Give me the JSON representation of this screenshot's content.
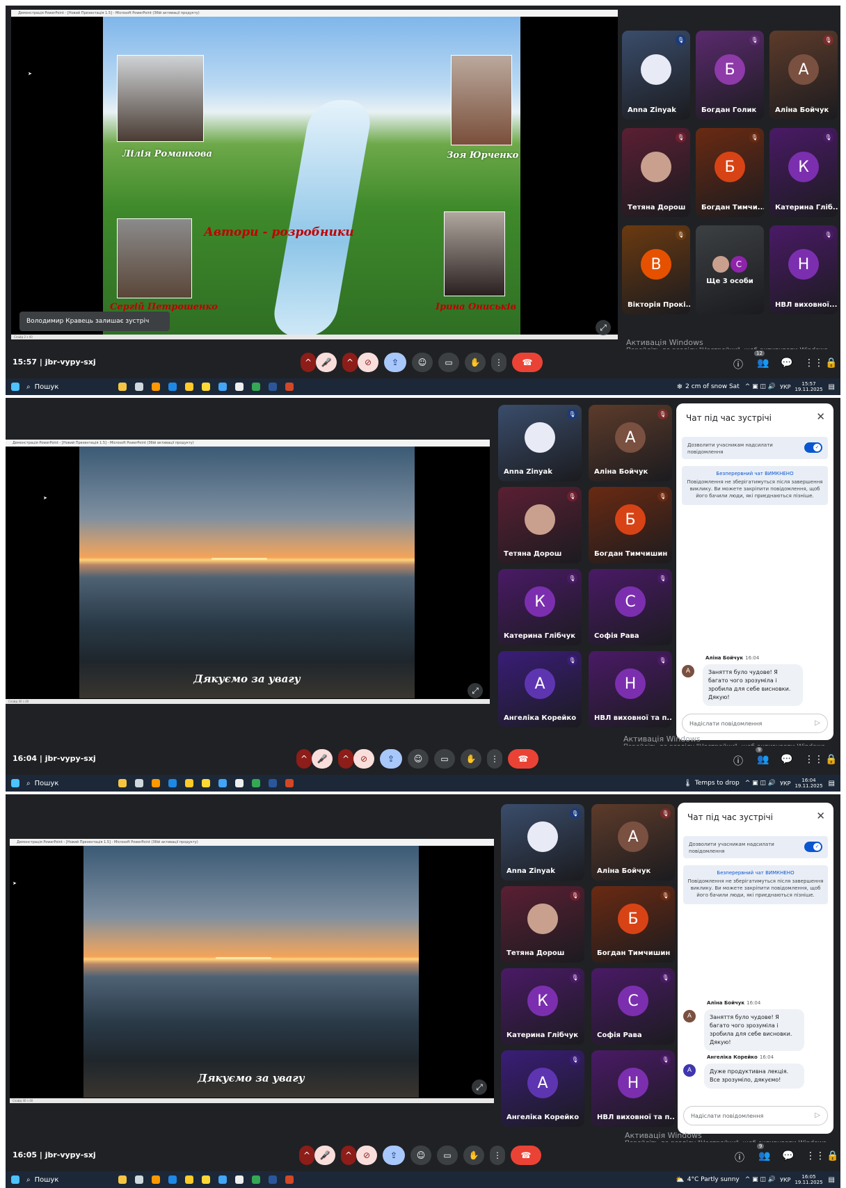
{
  "colors": {
    "meet_bg": "#202124",
    "end_call": "#ea4335",
    "accent": "#0b57d0"
  },
  "screens": [
    {
      "window_title": "Демонстрація PowerPoint - [Новий Презентація 1.5] - Microsoft PowerPoint (Збій активації продукту)",
      "status_left": "Слайд 2 з 40",
      "slide": {
        "people": [
          "Лілія Романкова",
          "Зоя Юрченко",
          "Сергій Петрошенко",
          "Ірина Ониськів"
        ],
        "heading": "Автори - розробники"
      },
      "notice": "Володимир Кравець залишає зустріч",
      "meeting": {
        "time": "15:57",
        "code": "jbr-vypy-sxj"
      },
      "participant_count": "12",
      "tiles": [
        {
          "name": "Anna Zinyak",
          "initial": "",
          "bg": "#3a4d6b",
          "av": "#e8eaf6",
          "muted": true,
          "mic": "#1a3a7a"
        },
        {
          "name": "Богдан Голик",
          "initial": "Б",
          "bg": "#5b2a6e",
          "av": "#8e3aa8",
          "muted": true,
          "mic": "#5b2a6e"
        },
        {
          "name": "Аліна Бойчук",
          "initial": "А",
          "bg": "#5d3b2a",
          "av": "#7a5040",
          "muted": true,
          "mic": "#7a2b2b"
        },
        {
          "name": "Тетяна Дорош",
          "initial": "",
          "bg": "#5a1f33",
          "av": "#c9a08e",
          "muted": true,
          "mic": "#6e1f30"
        },
        {
          "name": "Богдан Тимчи...",
          "initial": "Б",
          "bg": "#6a2a12",
          "av": "#d84315",
          "muted": true,
          "mic": "#6a2a12"
        },
        {
          "name": "Катерина Глiб...",
          "initial": "К",
          "bg": "#4a1a66",
          "av": "#7b2fae",
          "muted": true,
          "mic": "#4a1a66"
        },
        {
          "name": "Вікторія Прокі...",
          "initial": "В",
          "bg": "#6b3a10",
          "av": "#e65100",
          "muted": true,
          "mic": "#6b3a10"
        },
        {
          "name": "Ще 3 особи",
          "initial": "",
          "bg": "#3c4043",
          "av": "#3c4043",
          "muted": false,
          "mic": "#3c4043"
        },
        {
          "name": "НВЛ виховної...",
          "initial": "Н",
          "bg": "#4a1a66",
          "av": "#7b2fae",
          "muted": true,
          "mic": "#4a1a66"
        }
      ],
      "more_people_initial": "С",
      "activation": {
        "title": "Активація Windows",
        "sub": "Перейдіть до розділу \"Настройки\", щоб активувати Windows."
      },
      "taskbar": {
        "search": "Пошук",
        "weather": "2 cm of snow Sat",
        "lang": "УКР",
        "time": "15:57",
        "date": "19.11.2025"
      }
    },
    {
      "window_title": "Демонстрація PowerPoint - [Новий Презентація 1.5] - Microsoft PowerPoint (Збій активації продукту)",
      "status_left": "Слайд 40 з 40",
      "slide": {
        "thanks": "Дякуємо за увагу"
      },
      "meeting": {
        "time": "16:04",
        "code": "jbr-vypy-sxj"
      },
      "participant_count": "9",
      "tiles": [
        {
          "name": "Anna Zinyak",
          "initial": "",
          "bg": "#3a4d6b",
          "av": "#e8eaf6",
          "muted": true,
          "mic": "#1a3a7a"
        },
        {
          "name": "Аліна Бойчук",
          "initial": "А",
          "bg": "#5d3b2a",
          "av": "#7a5040",
          "muted": true,
          "mic": "#7a2b2b"
        },
        {
          "name": "Тетяна Дорош",
          "initial": "",
          "bg": "#5a1f33",
          "av": "#c9a08e",
          "muted": true,
          "mic": "#6e1f30"
        },
        {
          "name": "Богдан Тимчишин",
          "initial": "Б",
          "bg": "#6a2a12",
          "av": "#d84315",
          "muted": true,
          "mic": "#6a2a12"
        },
        {
          "name": "Катерина Глiбчук",
          "initial": "К",
          "bg": "#4a1a66",
          "av": "#7b2fae",
          "muted": true,
          "mic": "#4a1a66"
        },
        {
          "name": "Софія Рава",
          "initial": "С",
          "bg": "#4a1a66",
          "av": "#7b2fae",
          "muted": true,
          "mic": "#4a1a66"
        },
        {
          "name": "Ангеліка Корейко",
          "initial": "А",
          "bg": "#3a1d78",
          "av": "#5e35b1",
          "muted": true,
          "mic": "#3a1d78"
        },
        {
          "name": "НВЛ виховної та п...",
          "initial": "Н",
          "bg": "#4a1a66",
          "av": "#7b2fae",
          "muted": true,
          "mic": "#4a1a66"
        }
      ],
      "chat": {
        "title": "Чат під час зустрічі",
        "toggle_label": "Дозволити учасникам надсилати повідомлення",
        "info_title": "Безперервний чат ВИМКНЕНО",
        "info_text": "Повідомлення не зберігатимуться після завершення виклику. Ви можете закріпити повідомлення, щоб його бачили люди, які приєднаються пізніше.",
        "messages": [
          {
            "author": "Аліна Бойчук",
            "time": "16:04",
            "text": "Заняття було чудове! Я багато чого зрозуміла і зробила для себе висновки. Дякую!",
            "initial": "А",
            "color": "#7a5040"
          }
        ],
        "placeholder": "Надіслати повідомлення"
      },
      "activation": {
        "title": "Активація Windows",
        "sub": "Перейдіть до розділу \"Настройки\", щоб активувати Windows."
      },
      "taskbar": {
        "search": "Пошук",
        "weather": "Temps to drop",
        "lang": "УКР",
        "time": "16:04",
        "date": "19.11.2025"
      }
    },
    {
      "window_title": "Демонстрація PowerPoint - [Новий Презентація 1.5] - Microsoft PowerPoint (Збій активації продукту)",
      "status_left": "Слайд 40 з 40",
      "slide": {
        "thanks": "Дякуємо за увагу"
      },
      "meeting": {
        "time": "16:05",
        "code": "jbr-vypy-sxj"
      },
      "participant_count": "9",
      "tiles": [
        {
          "name": "Anna Zinyak",
          "initial": "",
          "bg": "#3a4d6b",
          "av": "#e8eaf6",
          "muted": true,
          "mic": "#1a3a7a"
        },
        {
          "name": "Аліна Бойчук",
          "initial": "А",
          "bg": "#5d3b2a",
          "av": "#7a5040",
          "muted": true,
          "mic": "#7a2b2b"
        },
        {
          "name": "Тетяна Дорош",
          "initial": "",
          "bg": "#5a1f33",
          "av": "#c9a08e",
          "muted": true,
          "mic": "#6e1f30"
        },
        {
          "name": "Богдан Тимчишин",
          "initial": "Б",
          "bg": "#6a2a12",
          "av": "#d84315",
          "muted": true,
          "mic": "#6a2a12"
        },
        {
          "name": "Катерина Глiбчук",
          "initial": "К",
          "bg": "#4a1a66",
          "av": "#7b2fae",
          "muted": true,
          "mic": "#4a1a66"
        },
        {
          "name": "Софія Рава",
          "initial": "С",
          "bg": "#4a1a66",
          "av": "#7b2fae",
          "muted": true,
          "mic": "#4a1a66"
        },
        {
          "name": "Ангеліка Корейко",
          "initial": "А",
          "bg": "#3a1d78",
          "av": "#5e35b1",
          "muted": true,
          "mic": "#3a1d78"
        },
        {
          "name": "НВЛ виховної та п...",
          "initial": "Н",
          "bg": "#4a1a66",
          "av": "#7b2fae",
          "muted": true,
          "mic": "#4a1a66"
        }
      ],
      "chat": {
        "title": "Чат під час зустрічі",
        "toggle_label": "Дозволити учасникам надсилати повідомлення",
        "info_title": "Безперервний чат ВИМКНЕНО",
        "info_text": "Повідомлення не зберігатимуться після завершення виклику. Ви можете закріпити повідомлення, щоб його бачили люди, які приєднаються пізніше.",
        "messages": [
          {
            "author": "Аліна Бойчук",
            "time": "16:04",
            "text": "Заняття було чудове! Я багато чого зрозуміла і зробила для себе висновки. Дякую!",
            "initial": "А",
            "color": "#7a5040"
          },
          {
            "author": "Ангеліка Корейко",
            "time": "16:04",
            "text": "Дуже продуктивна лекція. Все зрозуміло, дякуємо!",
            "initial": "А",
            "color": "#3f36b0"
          }
        ],
        "placeholder": "Надіслати повідомлення"
      },
      "activation": {
        "title": "Активація Windows",
        "sub": "Перейдіть до розділу \"Настройки\", щоб активувати Windows."
      },
      "taskbar": {
        "search": "Пошук",
        "weather": "4°C Partly sunny",
        "lang": "УКР",
        "time": "16:05",
        "date": "19.11.2025"
      }
    }
  ]
}
